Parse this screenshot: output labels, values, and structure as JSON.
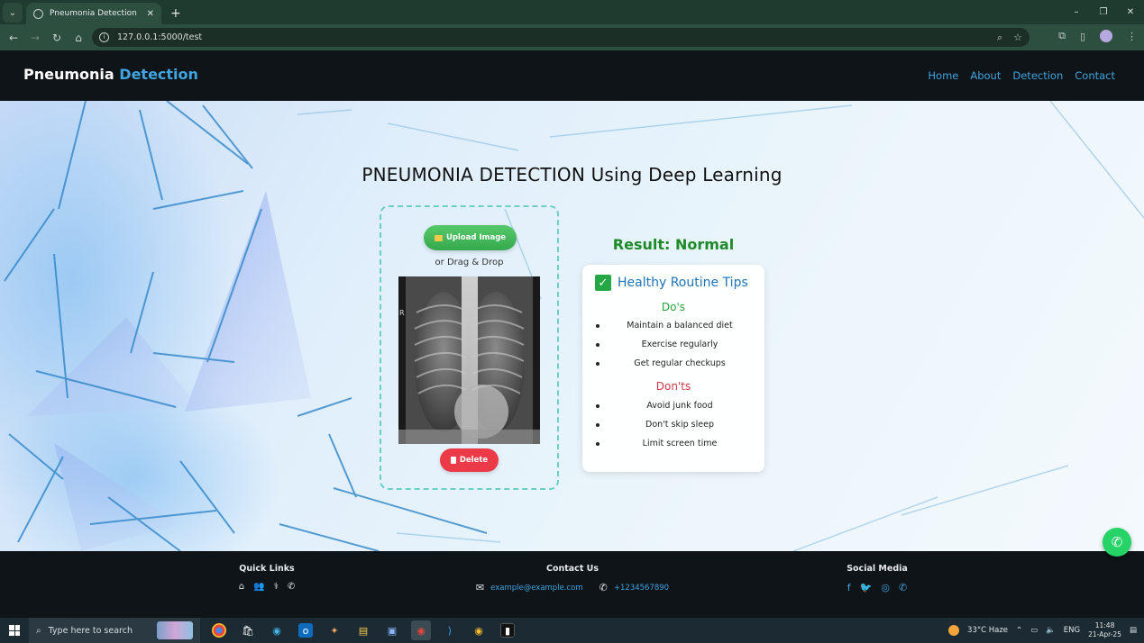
{
  "browser": {
    "tab_title": "Pneumonia Detection",
    "url": "127.0.0.1:5000/test",
    "new_tab": "+",
    "win_min": "–",
    "win_max": "❐",
    "win_close": "✕"
  },
  "site": {
    "brand_main": "Pneumonia",
    "brand_accent": "Detection",
    "nav": [
      "Home",
      "About",
      "Detection",
      "Contact"
    ]
  },
  "main": {
    "title": "PNEUMONIA DETECTION Using Deep Learning",
    "upload_label": "Upload Image",
    "drag_text": "or Drag & Drop",
    "xray_marker": "R",
    "delete_label": "Delete"
  },
  "result": {
    "text": "Result: Normal",
    "tips_title": "Healthy Routine Tips",
    "dos_heading": "Do's",
    "dos": [
      "Maintain a balanced diet",
      "Exercise regularly",
      "Get regular checkups"
    ],
    "donts_heading": "Don'ts",
    "donts": [
      "Avoid junk food",
      "Don't skip sleep",
      "Limit screen time"
    ]
  },
  "footer": {
    "quick_links_title": "Quick Links",
    "contact_title": "Contact Us",
    "email": "example@example.com",
    "phone": "+1234567890",
    "social_title": "Social Media"
  },
  "taskbar": {
    "search_placeholder": "Type here to search",
    "weather": "33°C  Haze",
    "language": "ENG",
    "time": "11:48",
    "date": "21-Apr-25"
  },
  "colors": {
    "accent_blue": "#3fa4e0",
    "result_green": "#1e8a2a",
    "dont_red": "#d0394a",
    "upload_green": "#36a94e",
    "delete_red": "#ec3a48"
  }
}
